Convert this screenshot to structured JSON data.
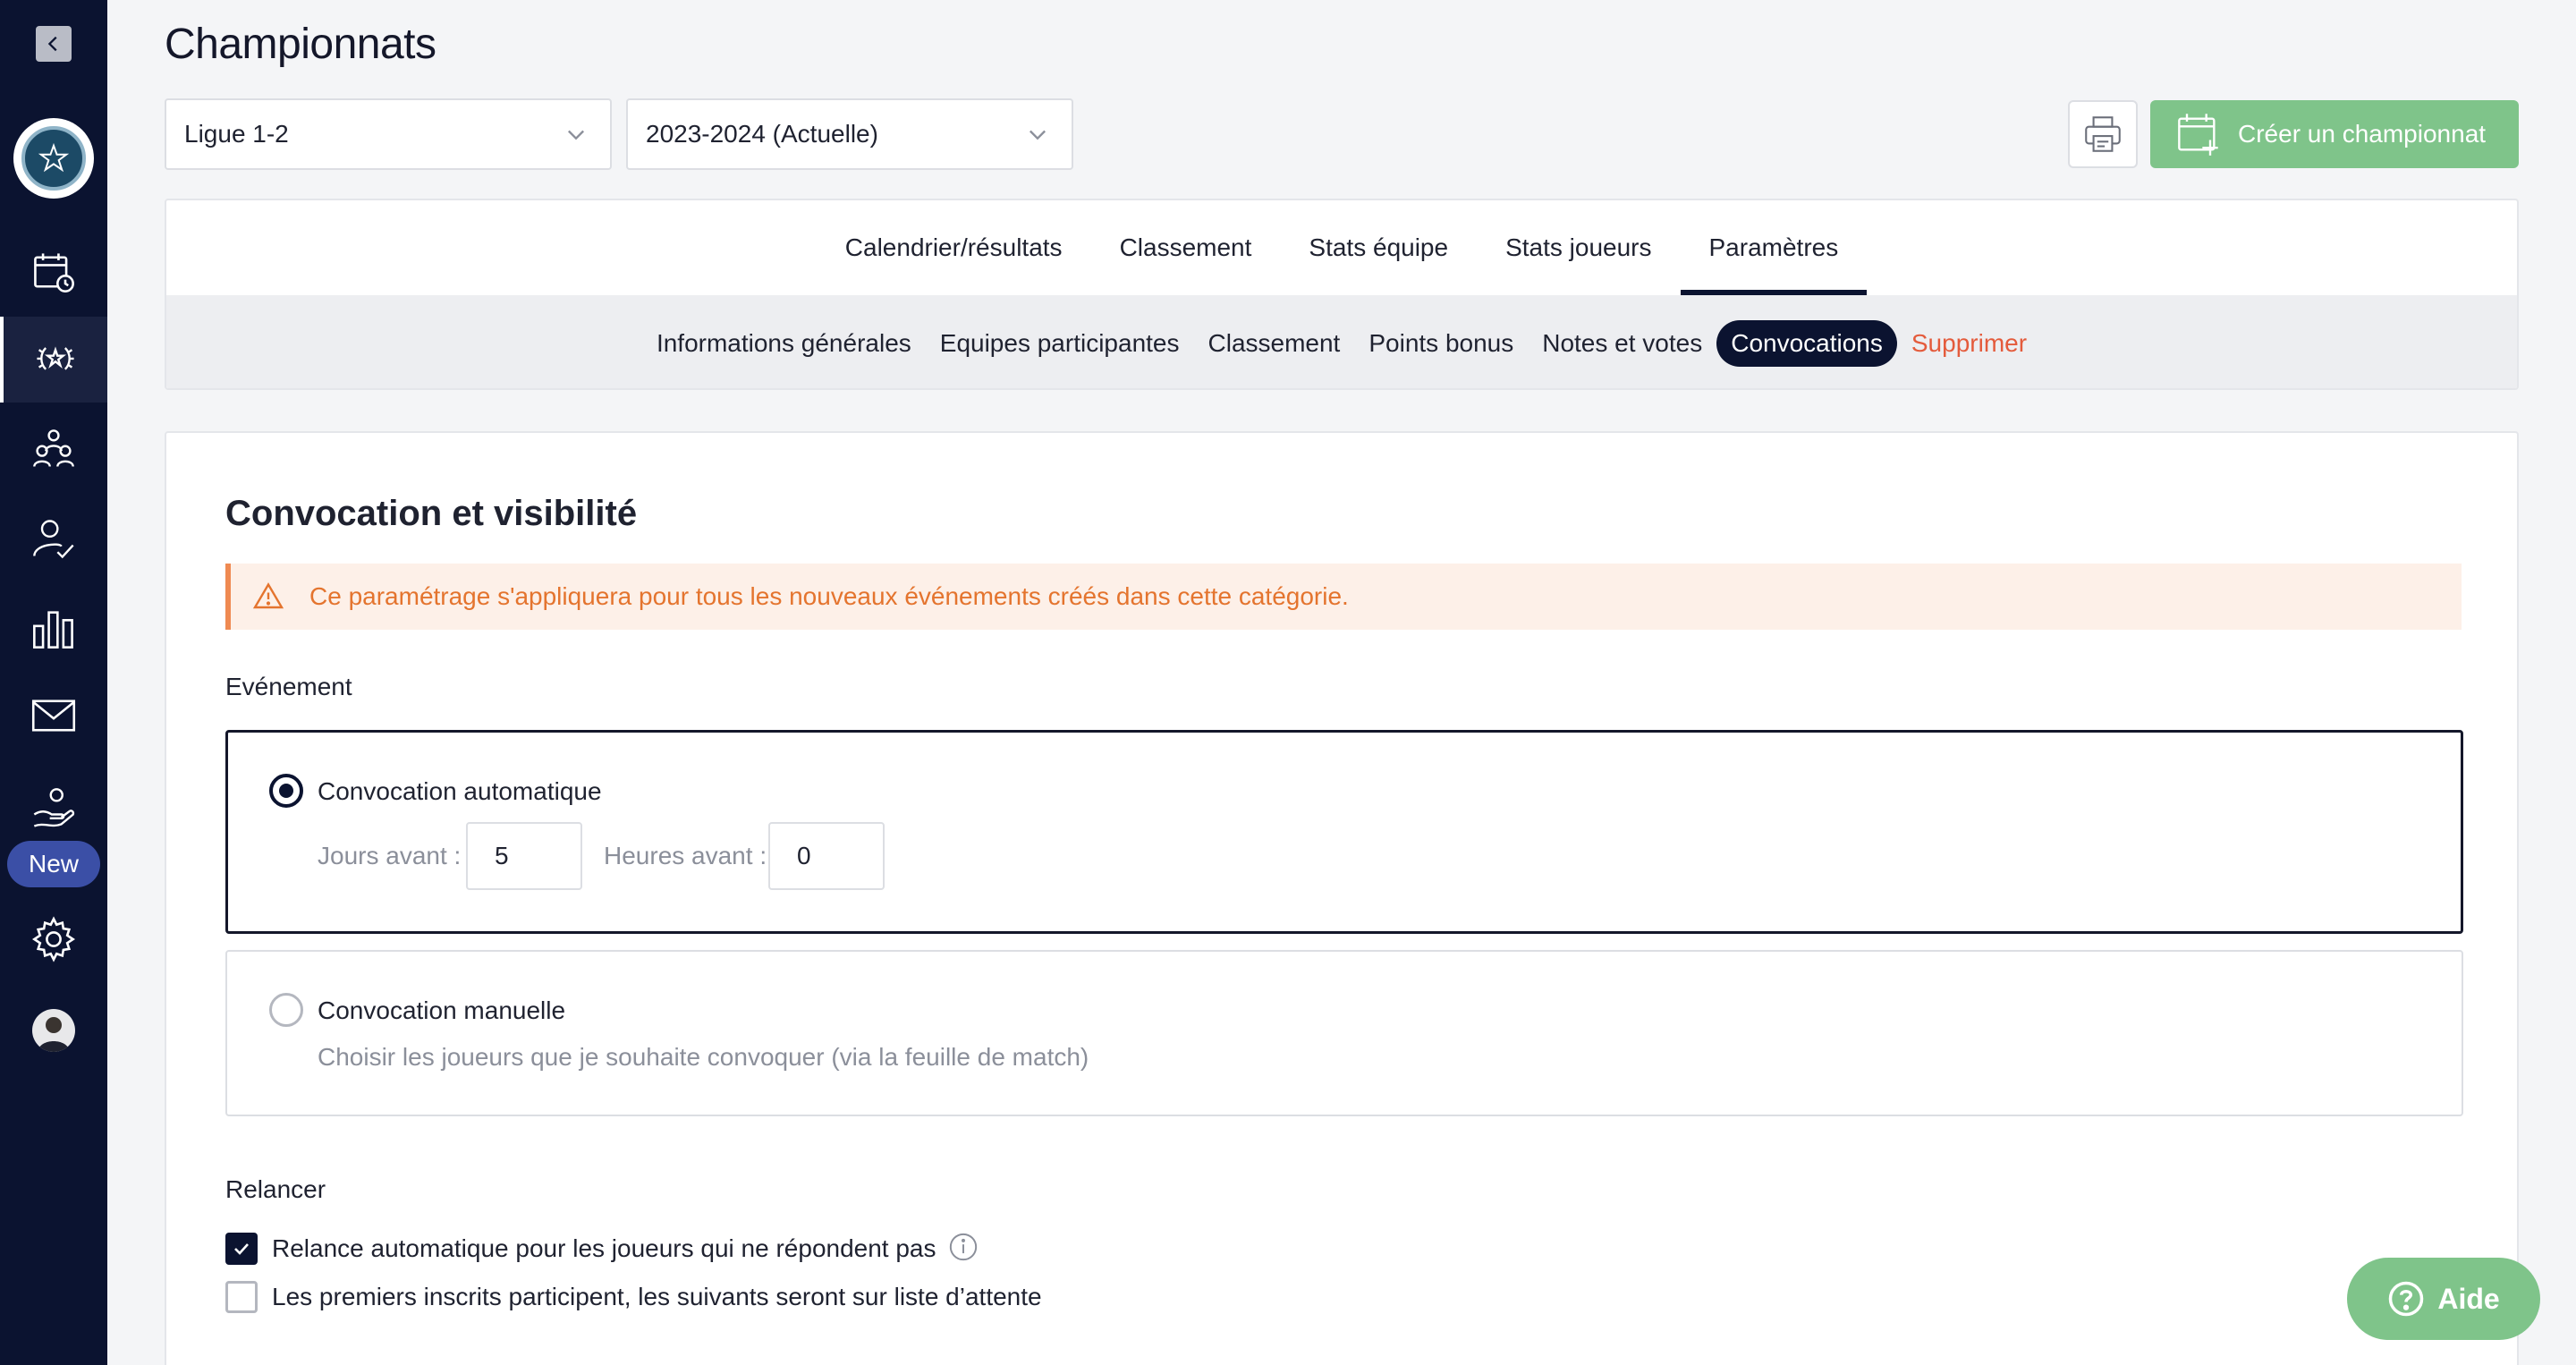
{
  "page": {
    "title": "Championnats"
  },
  "sidebar": {
    "new_badge": "New"
  },
  "filters": {
    "league": {
      "value": "Ligue 1-2"
    },
    "season": {
      "value": "2023-2024 (Actuelle)"
    }
  },
  "toolbar": {
    "create_label": "Créer un championnat"
  },
  "main_tabs": [
    {
      "label": "Calendrier/résultats",
      "active": false
    },
    {
      "label": "Classement",
      "active": false
    },
    {
      "label": "Stats équipe",
      "active": false
    },
    {
      "label": "Stats joueurs",
      "active": false
    },
    {
      "label": "Paramètres",
      "active": true
    }
  ],
  "sub_tabs": [
    {
      "label": "Informations générales"
    },
    {
      "label": "Equipes participantes"
    },
    {
      "label": "Classement"
    },
    {
      "label": "Points bonus"
    },
    {
      "label": "Notes et votes"
    },
    {
      "label": "Convocations",
      "active": true
    },
    {
      "label": "Supprimer",
      "danger": true
    }
  ],
  "content": {
    "section_title": "Convocation et visibilité",
    "alert_text": "Ce paramétrage s'appliquera pour tous les nouveaux événements créés dans cette catégorie.",
    "event_label": "Evénement",
    "auto": {
      "title": "Convocation automatique",
      "days_label": "Jours avant :",
      "days_value": "5",
      "hours_label": "Heures avant :",
      "hours_value": "0"
    },
    "manual": {
      "title": "Convocation manuelle",
      "description": "Choisir les joueurs que je souhaite convoquer (via la feuille de match)"
    },
    "relaunch_label": "Relancer",
    "relaunch_auto": "Relance automatique pour les joueurs qui ne répondent pas",
    "waitlist": "Les premiers inscrits participent, les suivants seront sur liste d’attente"
  },
  "help": {
    "label": "Aide"
  },
  "colors": {
    "sidebar_bg": "#0b1330",
    "accent_green": "#7fc48a",
    "alert_orange": "#e4742e",
    "danger_red": "#e45b3c"
  }
}
